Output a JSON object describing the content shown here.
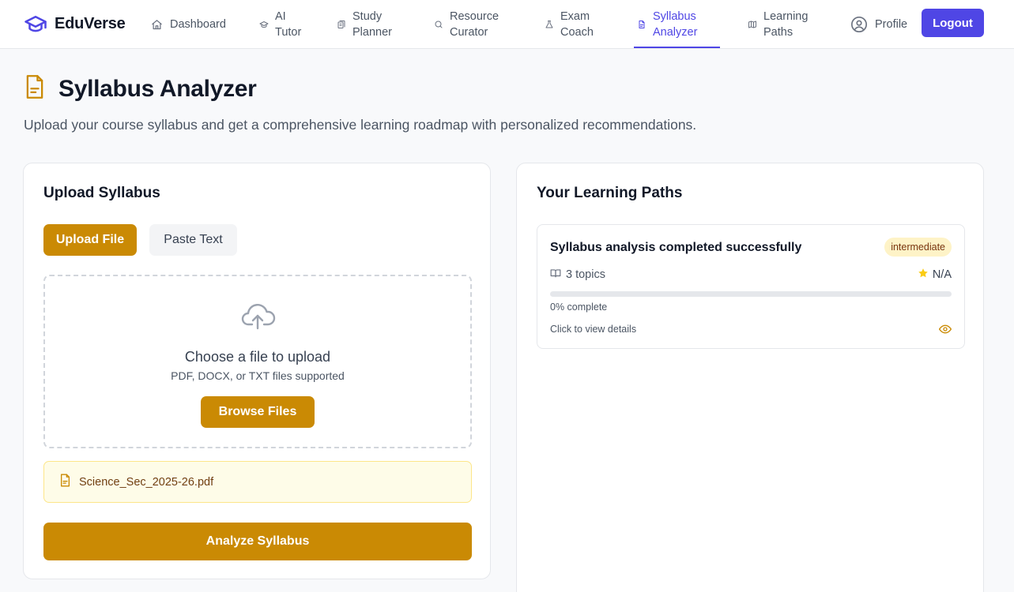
{
  "app": {
    "brand_name": "EduVerse",
    "colors": {
      "primary": "#4f46e5",
      "accent": "#ca8a04",
      "accent_soft": "#fefce8",
      "badge_bg": "#fef3c7",
      "star": "#facc15"
    }
  },
  "nav": {
    "items": [
      {
        "line1": "Dashboard",
        "line2": "",
        "icon": "home-icon"
      },
      {
        "line1": "AI",
        "line2": "Tutor",
        "icon": "graduation-cap-icon"
      },
      {
        "line1": "Study",
        "line2": "Planner",
        "icon": "book-stack-icon"
      },
      {
        "line1": "Resource",
        "line2": "Curator",
        "icon": "search-icon"
      },
      {
        "line1": "Exam",
        "line2": "Coach",
        "icon": "flask-icon"
      },
      {
        "line1": "Syllabus",
        "line2": "Analyzer",
        "icon": "document-icon",
        "active": true
      },
      {
        "line1": "Learning",
        "line2": "Paths",
        "icon": "map-icon"
      }
    ],
    "profile_label": "Profile",
    "logout_label": "Logout"
  },
  "page": {
    "title": "Syllabus Analyzer",
    "subtitle": "Upload your course syllabus and get a comprehensive learning roadmap with personalized recommendations.",
    "title_icon": "document-icon"
  },
  "upload": {
    "title": "Upload Syllabus",
    "tabs": [
      "Upload File",
      "Paste Text"
    ],
    "active_tab": "Upload File",
    "dropzone": {
      "icon": "cloud-upload-icon",
      "title": "Choose a file to upload",
      "subtitle": "PDF, DOCX, or TXT files supported",
      "browse_label": "Browse Files"
    },
    "selected_file": {
      "name": "Science_Sec_2025-26.pdf",
      "icon": "file-text-icon"
    },
    "analyze_label": "Analyze Syllabus"
  },
  "paths": {
    "title": "Your Learning Paths",
    "items": [
      {
        "title": "Syllabus analysis completed successfully",
        "level": "intermediate",
        "topics": "3 topics",
        "rating": "N/A",
        "progress": 0,
        "progress_label": "0% complete",
        "hint": "Click to view details"
      }
    ]
  }
}
